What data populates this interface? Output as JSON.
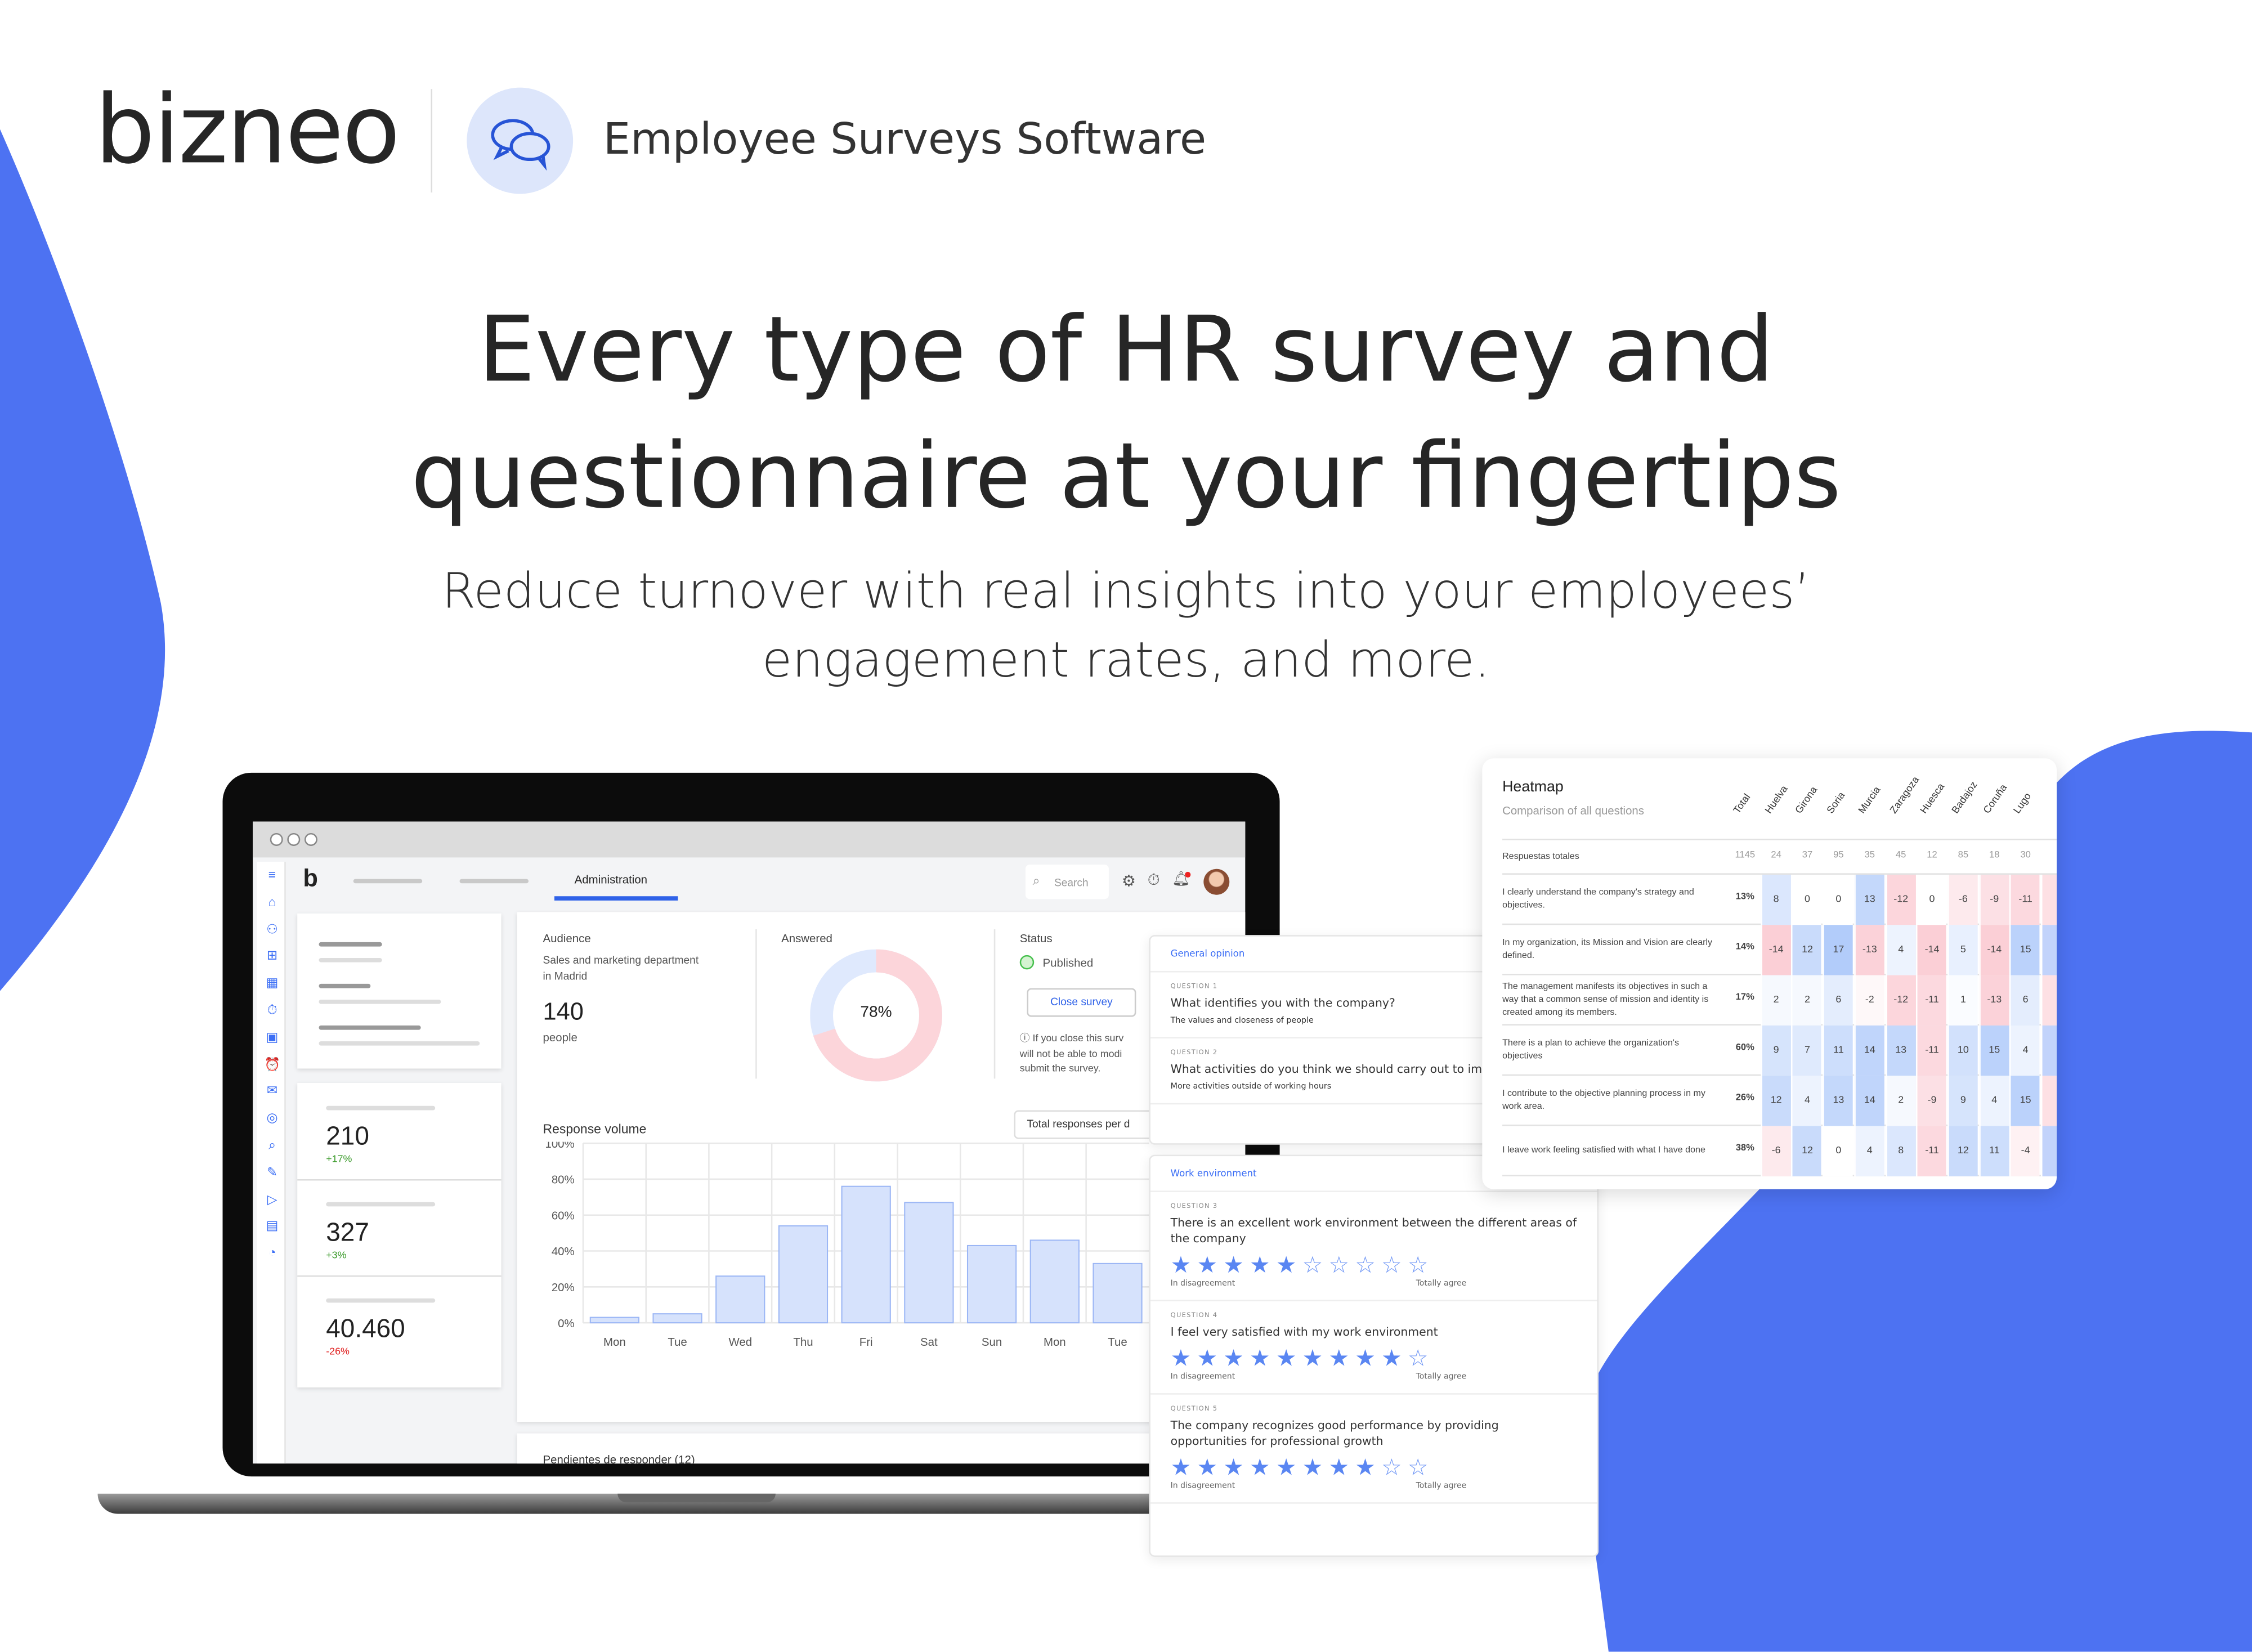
{
  "brand": {
    "logo": "bizneo",
    "product": "Employee Surveys Software",
    "product_icon": "chat-bubbles-icon",
    "accent": "#4d72f2"
  },
  "hero": {
    "headline_1": "Every type of HR survey and",
    "headline_2": "questionnaire at your fingertips",
    "sub_1": "Reduce turnover with real insights into your employees’",
    "sub_2": "engagement rates, and more."
  },
  "dashboard": {
    "nav": {
      "active_tab": "Administration",
      "search_placeholder": "Search"
    },
    "sidebar_icons": [
      "menu-icon",
      "home-icon",
      "people-icon",
      "org-chart-icon",
      "calendar-icon",
      "timer-icon",
      "id-card-icon",
      "alarm-icon",
      "chat-icon",
      "target-icon",
      "survey-icon",
      "training-icon",
      "play-icon",
      "meeting-icon",
      "pie-chart-icon"
    ],
    "kpis": [
      {
        "value": "210",
        "delta": "+17%",
        "trend": "up"
      },
      {
        "value": "327",
        "delta": "+3%",
        "trend": "up"
      },
      {
        "value": "40.460",
        "delta": "-26%",
        "trend": "down"
      }
    ],
    "audience": {
      "label": "Audience",
      "desc_1": "Sales and marketing department",
      "desc_2": "in Madrid",
      "count": "140",
      "unit": "people"
    },
    "answered": {
      "label": "Answered",
      "percent_label": "78%",
      "percent": 78
    },
    "status": {
      "label": "Status",
      "value": "Published",
      "button": "Close survey",
      "note_1": "If you close this surv",
      "note_2": "will not be able to modi",
      "note_3": "submit the survey."
    },
    "pending_label": "Pendientes de responder (12)"
  },
  "chart_data": {
    "type": "bar",
    "title": "Response volume",
    "dropdown": "Total responses per d",
    "categories": [
      "Mon",
      "Tue",
      "Wed",
      "Thu",
      "Fri",
      "Sat",
      "Sun",
      "Mon",
      "Tue"
    ],
    "values": [
      3,
      5,
      26,
      54,
      76,
      67,
      43,
      46,
      33
    ],
    "yticks": [
      "0%",
      "20%",
      "40%",
      "60%",
      "80%",
      "100%"
    ],
    "ylim": [
      0,
      100
    ],
    "grid": true
  },
  "survey": {
    "sections": [
      {
        "title": "General opinion",
        "questions": [
          {
            "num": "QUESTION 1",
            "text": "What identifies you with the company?",
            "answer": "The values and closeness of people"
          },
          {
            "num": "QUESTION 2",
            "text": "What activities do you think we should carry out to impro Environment?",
            "answer": "More activities outside of working hours"
          }
        ]
      },
      {
        "title": "Work environment",
        "questions": [
          {
            "num": "QUESTION 3",
            "text": "There is an excellent work environment between the different areas of the company",
            "rating": 5,
            "max": 10
          },
          {
            "num": "QUESTION 4",
            "text": "I feel very satisfied with my work environment",
            "rating": 9,
            "max": 10
          },
          {
            "num": "QUESTION 5",
            "text": "The company recognizes good performance by providing opportunities for professional growth",
            "rating": 8,
            "max": 10
          }
        ]
      }
    ],
    "scale_low": "In disagreement",
    "scale_high": "Totally agree"
  },
  "heatmap": {
    "title": "Heatmap",
    "subtitle": "Comparison of all questions",
    "columns": [
      "Total",
      "Huelva",
      "Girona",
      "Soria",
      "Murcia",
      "Zaragoza",
      "Huesca",
      "Badajoz",
      "Coruña",
      "Lugo"
    ],
    "totals_label": "Respuestas totales",
    "totals": [
      "1145",
      "24",
      "37",
      "95",
      "35",
      "45",
      "12",
      "85",
      "18",
      "30"
    ],
    "rows": [
      {
        "q": "I clearly understand the company's strategy and objectives.",
        "total": "13%",
        "values": [
          8,
          0,
          0,
          13,
          -12,
          0,
          -6,
          -9,
          -11
        ]
      },
      {
        "q": "In my organization, its Mission and Vision are clearly defined.",
        "total": "14%",
        "values": [
          -14,
          12,
          17,
          -13,
          4,
          -14,
          5,
          -14,
          15
        ]
      },
      {
        "q": "The management manifests its objectives in such a way that a common sense of mission and identity is created among its members.",
        "total": "17%",
        "values": [
          2,
          2,
          6,
          -2,
          -12,
          -11,
          1,
          -13,
          6
        ]
      },
      {
        "q": "There is a plan to achieve the organization's objectives",
        "total": "60%",
        "values": [
          9,
          7,
          11,
          14,
          13,
          -11,
          10,
          15,
          4
        ]
      },
      {
        "q": "I contribute to the objective planning process in my work area.",
        "total": "26%",
        "values": [
          12,
          4,
          13,
          14,
          2,
          -9,
          9,
          4,
          15
        ]
      },
      {
        "q": "I leave work feeling satisfied with what I have done",
        "total": "38%",
        "values": [
          -6,
          12,
          0,
          4,
          8,
          -11,
          12,
          11,
          -4
        ]
      }
    ]
  }
}
